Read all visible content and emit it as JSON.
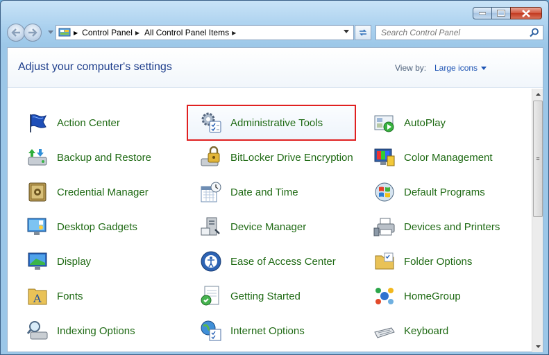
{
  "window": {
    "caption_buttons": [
      "minimize",
      "maximize",
      "close"
    ]
  },
  "address": {
    "crumbs": [
      "Control Panel",
      "All Control Panel Items"
    ]
  },
  "search": {
    "placeholder": "Search Control Panel"
  },
  "header": {
    "title": "Adjust your computer's settings",
    "view_by_label": "View by:",
    "view_by_value": "Large icons"
  },
  "items": [
    {
      "label": "Action Center",
      "icon": "flag-icon"
    },
    {
      "label": "Administrative Tools",
      "icon": "gears-icon",
      "selected": true
    },
    {
      "label": "AutoPlay",
      "icon": "autoplay-icon"
    },
    {
      "label": "Backup and Restore",
      "icon": "backup-icon"
    },
    {
      "label": "BitLocker Drive Encryption",
      "icon": "lock-drive-icon"
    },
    {
      "label": "Color Management",
      "icon": "color-monitor-icon"
    },
    {
      "label": "Credential Manager",
      "icon": "vault-icon"
    },
    {
      "label": "Date and Time",
      "icon": "clock-calendar-icon"
    },
    {
      "label": "Default Programs",
      "icon": "windows-globe-icon"
    },
    {
      "label": "Desktop Gadgets",
      "icon": "gadgets-monitor-icon"
    },
    {
      "label": "Device Manager",
      "icon": "device-manager-icon"
    },
    {
      "label": "Devices and Printers",
      "icon": "printer-icon"
    },
    {
      "label": "Display",
      "icon": "display-monitor-icon"
    },
    {
      "label": "Ease of Access Center",
      "icon": "ease-of-access-icon"
    },
    {
      "label": "Folder Options",
      "icon": "folder-icon"
    },
    {
      "label": "Fonts",
      "icon": "fonts-folder-icon"
    },
    {
      "label": "Getting Started",
      "icon": "getting-started-icon"
    },
    {
      "label": "HomeGroup",
      "icon": "homegroup-icon"
    },
    {
      "label": "Indexing Options",
      "icon": "magnifier-drive-icon"
    },
    {
      "label": "Internet Options",
      "icon": "globe-check-icon"
    },
    {
      "label": "Keyboard",
      "icon": "keyboard-icon"
    }
  ],
  "colors": {
    "link_green": "#1f6a14",
    "title_blue": "#1e3e8c",
    "highlight_red": "#e02020"
  }
}
